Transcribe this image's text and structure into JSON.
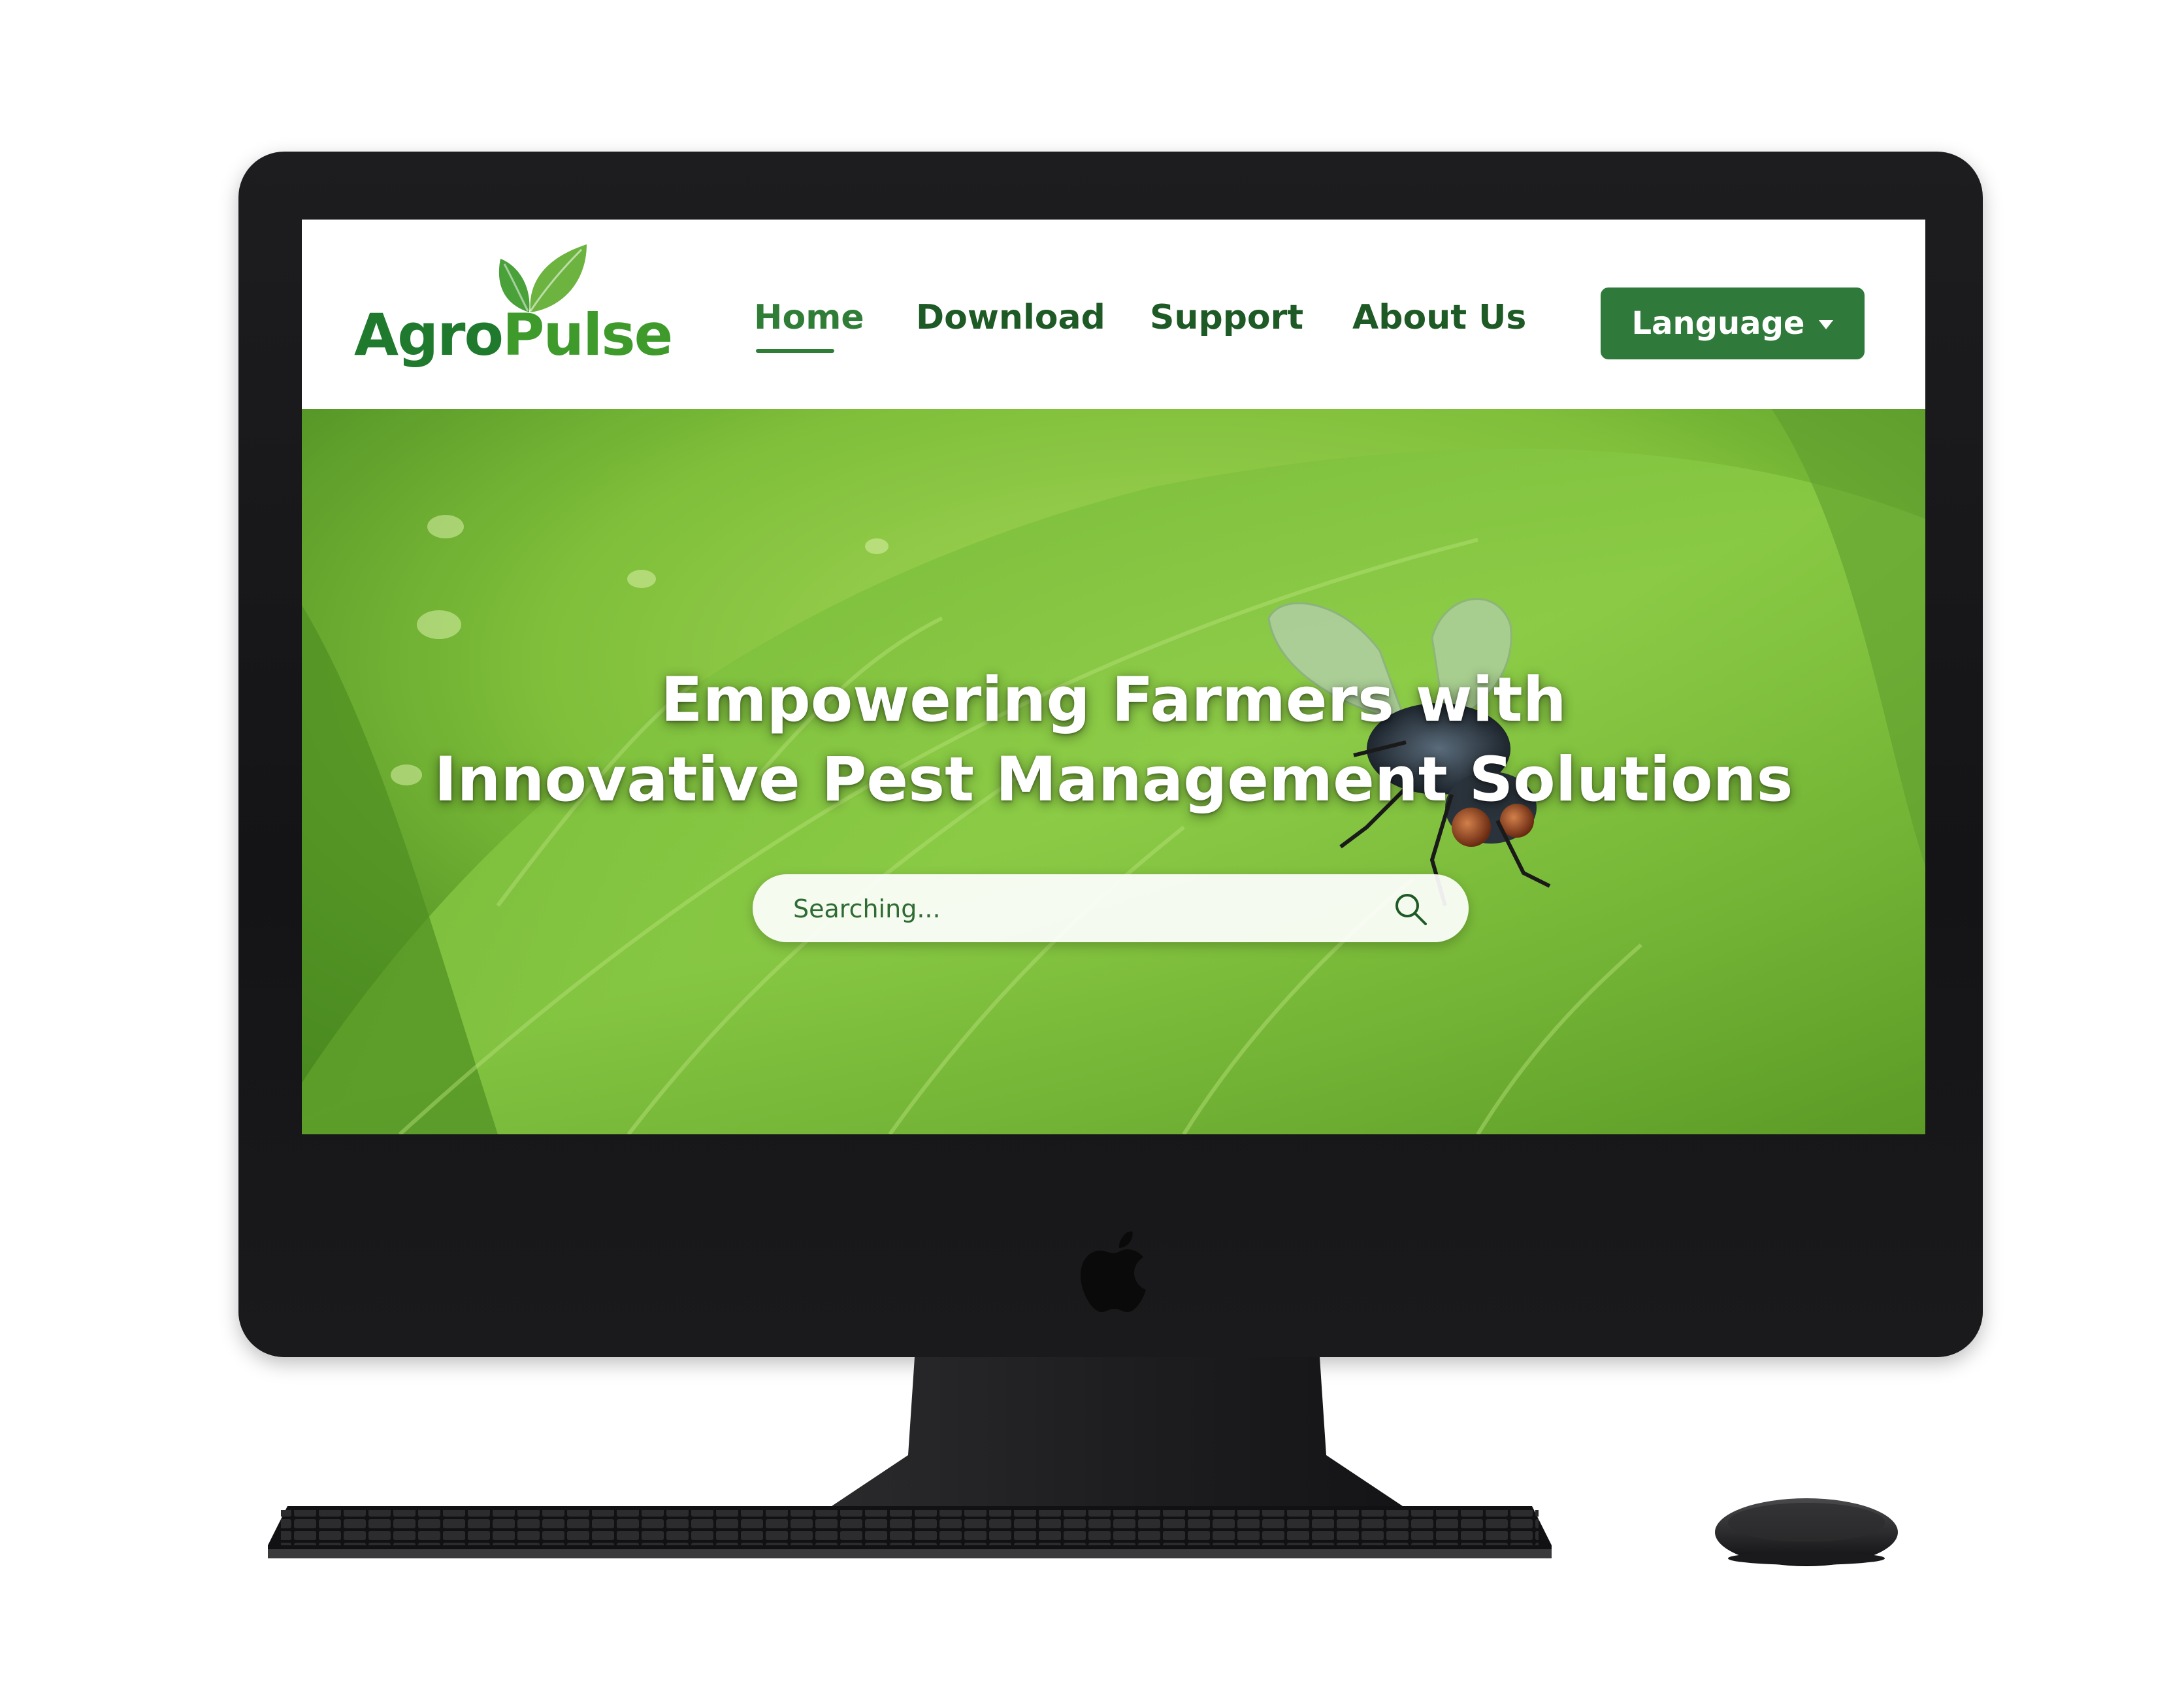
{
  "site": {
    "logo": {
      "part1": "Agro",
      "part2": "Pulse",
      "icon": "leaf-icon"
    },
    "nav": {
      "items": [
        {
          "label": "Home",
          "active": true
        },
        {
          "label": "Download",
          "active": false
        },
        {
          "label": "Support",
          "active": false
        },
        {
          "label": "About Us",
          "active": false
        }
      ],
      "language_button": {
        "label": "Language",
        "icon": "caret-down-icon"
      }
    },
    "hero": {
      "title_line1": "Empowering Farmers with",
      "title_line2": "Innovative Pest Management Solutions",
      "search": {
        "placeholder": "Searching...",
        "value": "",
        "icon": "search-icon"
      }
    }
  },
  "colors": {
    "brand_dark_green": "#1e5a25",
    "brand_green": "#2f7a3a",
    "logo_light_green": "#3f9a2c",
    "leaf_green": "#6cb33f",
    "device_frame": "#1a1a1c"
  },
  "device": {
    "type": "iMac",
    "logo": "apple-logo",
    "peripherals": [
      "keyboard",
      "mouse"
    ]
  }
}
